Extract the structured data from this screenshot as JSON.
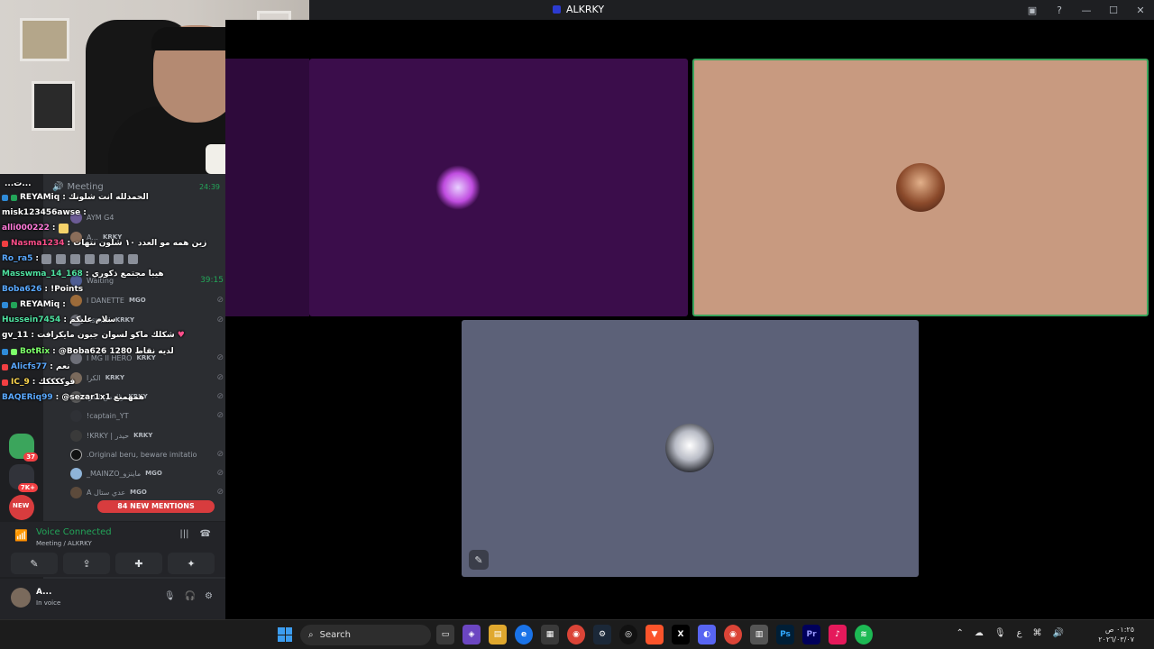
{
  "window": {
    "title": "ALKRKY",
    "controls": [
      "inbox-icon",
      "help-icon",
      "minimize-icon",
      "maximize-icon",
      "close-icon"
    ]
  },
  "sidebar": {
    "channel": {
      "name": "Meeting",
      "timer": "24:39"
    },
    "members": [
      {
        "name": "AYM G4",
        "tag": ""
      },
      {
        "name": "A...",
        "tag": "KRKY"
      },
      {
        "name": "Waiting",
        "tag": "",
        "time": "39:15"
      },
      {
        "name": "l DANETTE",
        "tag": "MGO"
      },
      {
        "name": "Asmail",
        "tag": "KRKY"
      },
      {
        "name": "I MG ll HERO",
        "tag": "KRKY"
      },
      {
        "name": "الكرا",
        "tag": "KRKY"
      },
      {
        "name": "والدمن الكرا",
        "tag": "KRKY"
      },
      {
        "name": "!captain_YT",
        "tag": ""
      },
      {
        "name": "!KRKY | حيدر",
        "tag": "KRKY"
      },
      {
        "name": ".Original beru, beware imitatio",
        "tag": ""
      },
      {
        "name": "_MAINZO_ماينزو",
        "tag": "MGO"
      },
      {
        "name": "A عدي ستال",
        "tag": "MGO"
      }
    ],
    "mentions_label": "84 NEW MENTIONS",
    "server_badges": [
      "37",
      "7K+",
      "NEW"
    ],
    "voice": {
      "status": "Voice Connected",
      "location": "Meeting / ALKRKY"
    },
    "user": {
      "name": "A...",
      "status": "In voice"
    }
  },
  "chat": [
    {
      "user": "",
      "text": "...ت..."
    },
    {
      "user": "REYAMiq",
      "text": ": الحمدلله انت شلونك",
      "color": "#ffffff"
    },
    {
      "user": "misk123456awse",
      "text": ":",
      "color": "#ffffff"
    },
    {
      "user": "alli000222",
      "text": ":",
      "color": "#ff7ad9"
    },
    {
      "user": "Nasma1234",
      "text": ": زين همه مو العدد ١٠ شلون نتهات",
      "color": "#ff4f8b"
    },
    {
      "user": "Ro_ra5",
      "text": ":",
      "color": "#5aa9ff"
    },
    {
      "user": "Masswma_14_168",
      "text": ": هيبا مجتمع ذكوري",
      "color": "#4fe3a1"
    },
    {
      "user": "Boba626",
      "text": ": !Points",
      "color": "#5aa9ff"
    },
    {
      "user": "REYAMiq",
      "text": ":",
      "color": "#ffffff"
    },
    {
      "user": "Hussein7454",
      "text": ": سلام عليكم",
      "color": "#4fe3a1"
    },
    {
      "user": "gv_11",
      "text": ": شكلك ماكو لسوان جبون مايكرافت",
      "color": "#ffffff"
    },
    {
      "user": "BotRix",
      "text": ": @Boba626 1280 لديه نقاط",
      "color": "#7dff6a"
    },
    {
      "user": "Alicfs77",
      "text": ": نعم",
      "color": "#5aa9ff"
    },
    {
      "user": "IC_9",
      "text": ": فوككككك",
      "color": "#ffd84f"
    },
    {
      "user": "BAQERiq99",
      "text": ": @sezar1x1 همهمنع",
      "color": "#5aa9ff"
    }
  ],
  "stage": {
    "tiles": [
      "purple-avatar-tile",
      "tan-avatar-tile",
      "gray-avatar-tile"
    ]
  },
  "taskbar": {
    "search_placeholder": "Search",
    "apps": [
      "explorer",
      "copilot",
      "files",
      "edge",
      "store",
      "chrome",
      "steam",
      "obs",
      "brave",
      "x",
      "discord",
      "chrome-alt",
      "notepad",
      "photoshop",
      "premiere",
      "tiktok",
      "spotify"
    ],
    "clock_time": "٠١:٢٥ ص",
    "clock_date": "٢٠٢٦/٠٣/٠٧",
    "tray_lang": "ع"
  },
  "colors": {
    "accent": "#23a559",
    "mentions": "#d83c3e",
    "voice_border": "#3ba55c"
  }
}
